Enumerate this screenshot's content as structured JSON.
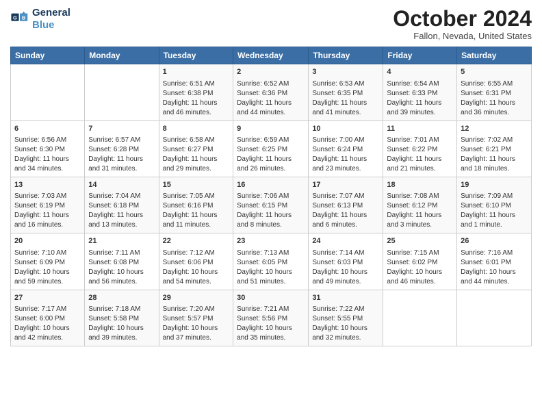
{
  "header": {
    "logo_line1": "General",
    "logo_line2": "Blue",
    "month": "October 2024",
    "location": "Fallon, Nevada, United States"
  },
  "days_of_week": [
    "Sunday",
    "Monday",
    "Tuesday",
    "Wednesday",
    "Thursday",
    "Friday",
    "Saturday"
  ],
  "weeks": [
    [
      {
        "day": "",
        "content": ""
      },
      {
        "day": "",
        "content": ""
      },
      {
        "day": "1",
        "content": "Sunrise: 6:51 AM\nSunset: 6:38 PM\nDaylight: 11 hours and 46 minutes."
      },
      {
        "day": "2",
        "content": "Sunrise: 6:52 AM\nSunset: 6:36 PM\nDaylight: 11 hours and 44 minutes."
      },
      {
        "day": "3",
        "content": "Sunrise: 6:53 AM\nSunset: 6:35 PM\nDaylight: 11 hours and 41 minutes."
      },
      {
        "day": "4",
        "content": "Sunrise: 6:54 AM\nSunset: 6:33 PM\nDaylight: 11 hours and 39 minutes."
      },
      {
        "day": "5",
        "content": "Sunrise: 6:55 AM\nSunset: 6:31 PM\nDaylight: 11 hours and 36 minutes."
      }
    ],
    [
      {
        "day": "6",
        "content": "Sunrise: 6:56 AM\nSunset: 6:30 PM\nDaylight: 11 hours and 34 minutes."
      },
      {
        "day": "7",
        "content": "Sunrise: 6:57 AM\nSunset: 6:28 PM\nDaylight: 11 hours and 31 minutes."
      },
      {
        "day": "8",
        "content": "Sunrise: 6:58 AM\nSunset: 6:27 PM\nDaylight: 11 hours and 29 minutes."
      },
      {
        "day": "9",
        "content": "Sunrise: 6:59 AM\nSunset: 6:25 PM\nDaylight: 11 hours and 26 minutes."
      },
      {
        "day": "10",
        "content": "Sunrise: 7:00 AM\nSunset: 6:24 PM\nDaylight: 11 hours and 23 minutes."
      },
      {
        "day": "11",
        "content": "Sunrise: 7:01 AM\nSunset: 6:22 PM\nDaylight: 11 hours and 21 minutes."
      },
      {
        "day": "12",
        "content": "Sunrise: 7:02 AM\nSunset: 6:21 PM\nDaylight: 11 hours and 18 minutes."
      }
    ],
    [
      {
        "day": "13",
        "content": "Sunrise: 7:03 AM\nSunset: 6:19 PM\nDaylight: 11 hours and 16 minutes."
      },
      {
        "day": "14",
        "content": "Sunrise: 7:04 AM\nSunset: 6:18 PM\nDaylight: 11 hours and 13 minutes."
      },
      {
        "day": "15",
        "content": "Sunrise: 7:05 AM\nSunset: 6:16 PM\nDaylight: 11 hours and 11 minutes."
      },
      {
        "day": "16",
        "content": "Sunrise: 7:06 AM\nSunset: 6:15 PM\nDaylight: 11 hours and 8 minutes."
      },
      {
        "day": "17",
        "content": "Sunrise: 7:07 AM\nSunset: 6:13 PM\nDaylight: 11 hours and 6 minutes."
      },
      {
        "day": "18",
        "content": "Sunrise: 7:08 AM\nSunset: 6:12 PM\nDaylight: 11 hours and 3 minutes."
      },
      {
        "day": "19",
        "content": "Sunrise: 7:09 AM\nSunset: 6:10 PM\nDaylight: 11 hours and 1 minute."
      }
    ],
    [
      {
        "day": "20",
        "content": "Sunrise: 7:10 AM\nSunset: 6:09 PM\nDaylight: 10 hours and 59 minutes."
      },
      {
        "day": "21",
        "content": "Sunrise: 7:11 AM\nSunset: 6:08 PM\nDaylight: 10 hours and 56 minutes."
      },
      {
        "day": "22",
        "content": "Sunrise: 7:12 AM\nSunset: 6:06 PM\nDaylight: 10 hours and 54 minutes."
      },
      {
        "day": "23",
        "content": "Sunrise: 7:13 AM\nSunset: 6:05 PM\nDaylight: 10 hours and 51 minutes."
      },
      {
        "day": "24",
        "content": "Sunrise: 7:14 AM\nSunset: 6:03 PM\nDaylight: 10 hours and 49 minutes."
      },
      {
        "day": "25",
        "content": "Sunrise: 7:15 AM\nSunset: 6:02 PM\nDaylight: 10 hours and 46 minutes."
      },
      {
        "day": "26",
        "content": "Sunrise: 7:16 AM\nSunset: 6:01 PM\nDaylight: 10 hours and 44 minutes."
      }
    ],
    [
      {
        "day": "27",
        "content": "Sunrise: 7:17 AM\nSunset: 6:00 PM\nDaylight: 10 hours and 42 minutes."
      },
      {
        "day": "28",
        "content": "Sunrise: 7:18 AM\nSunset: 5:58 PM\nDaylight: 10 hours and 39 minutes."
      },
      {
        "day": "29",
        "content": "Sunrise: 7:20 AM\nSunset: 5:57 PM\nDaylight: 10 hours and 37 minutes."
      },
      {
        "day": "30",
        "content": "Sunrise: 7:21 AM\nSunset: 5:56 PM\nDaylight: 10 hours and 35 minutes."
      },
      {
        "day": "31",
        "content": "Sunrise: 7:22 AM\nSunset: 5:55 PM\nDaylight: 10 hours and 32 minutes."
      },
      {
        "day": "",
        "content": ""
      },
      {
        "day": "",
        "content": ""
      }
    ]
  ]
}
